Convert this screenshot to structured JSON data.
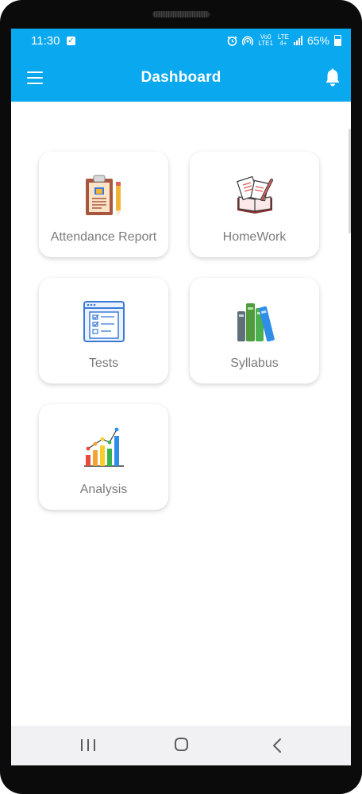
{
  "status_bar": {
    "time": "11:30",
    "network_top": "Vo0",
    "network_bottom": "LTE1",
    "lte_top": "LTE",
    "lte_bottom": "4+",
    "battery_percent": "65%"
  },
  "app_bar": {
    "title": "Dashboard",
    "menu_icon": "hamburger-menu-icon",
    "notification_icon": "bell-icon",
    "background_color": "#09a8ef"
  },
  "cards": [
    {
      "label": "Attendance Report",
      "icon": "clipboard-report-icon"
    },
    {
      "label": "HomeWork",
      "icon": "homework-book-icon"
    },
    {
      "label": "Tests",
      "icon": "test-checklist-icon"
    },
    {
      "label": "Syllabus",
      "icon": "syllabus-books-icon"
    },
    {
      "label": "Analysis",
      "icon": "analysis-chart-icon"
    }
  ],
  "nav_bar": {
    "recents_icon": "recents-icon",
    "home_icon": "home-icon",
    "back_icon": "back-icon"
  }
}
